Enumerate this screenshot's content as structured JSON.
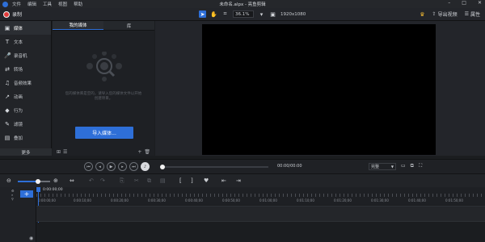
{
  "titlebar": {
    "menu": [
      "文件",
      "编辑",
      "工具",
      "视图",
      "帮助"
    ],
    "window_title": "未命名.alpx - 亮鱼剪辑",
    "controls": [
      "–",
      "□",
      "✕"
    ]
  },
  "toolbar": {
    "record_label": "录制",
    "zoom_value": "36.1%",
    "resolution": "1920x1080",
    "export_label": "导出视频",
    "properties_label": "属性"
  },
  "sidebar": {
    "items": [
      {
        "icon": "▣",
        "label": "媒体"
      },
      {
        "icon": "T",
        "label": "文本"
      },
      {
        "icon": "🎤",
        "label": "录音机"
      },
      {
        "icon": "⇄",
        "label": "转场"
      },
      {
        "icon": "♫",
        "label": "音频效果"
      },
      {
        "icon": "↗",
        "label": "动画"
      },
      {
        "icon": "◆",
        "label": "行为"
      },
      {
        "icon": "✎",
        "label": "滤镜"
      },
      {
        "icon": "▤",
        "label": "叠加"
      }
    ],
    "more_label": "更多"
  },
  "media": {
    "tabs": [
      "我的媒体",
      "库"
    ],
    "empty_text": "您的媒体库是空的，请导入您的媒体文件以开始创建项目。",
    "import_label": "导入媒体..."
  },
  "playback": {
    "timecode": "00:00/00:00",
    "fit_label": "完整"
  },
  "timeline": {
    "playhead_time": "0:00:00;00",
    "ticks": [
      "0:00:00;00",
      "0:00:10;00",
      "0:00:20;00",
      "0:00:30;00",
      "0:00:40;00",
      "0:00:50;00",
      "0:01:00;00",
      "0:01:10;00",
      "0:01:20;00",
      "0:01:30;00",
      "0:01:40;00",
      "0:01:50;00"
    ]
  },
  "colors": {
    "accent": "#2e6fd8",
    "record": "#e03a3a",
    "crown": "#e8b233"
  }
}
